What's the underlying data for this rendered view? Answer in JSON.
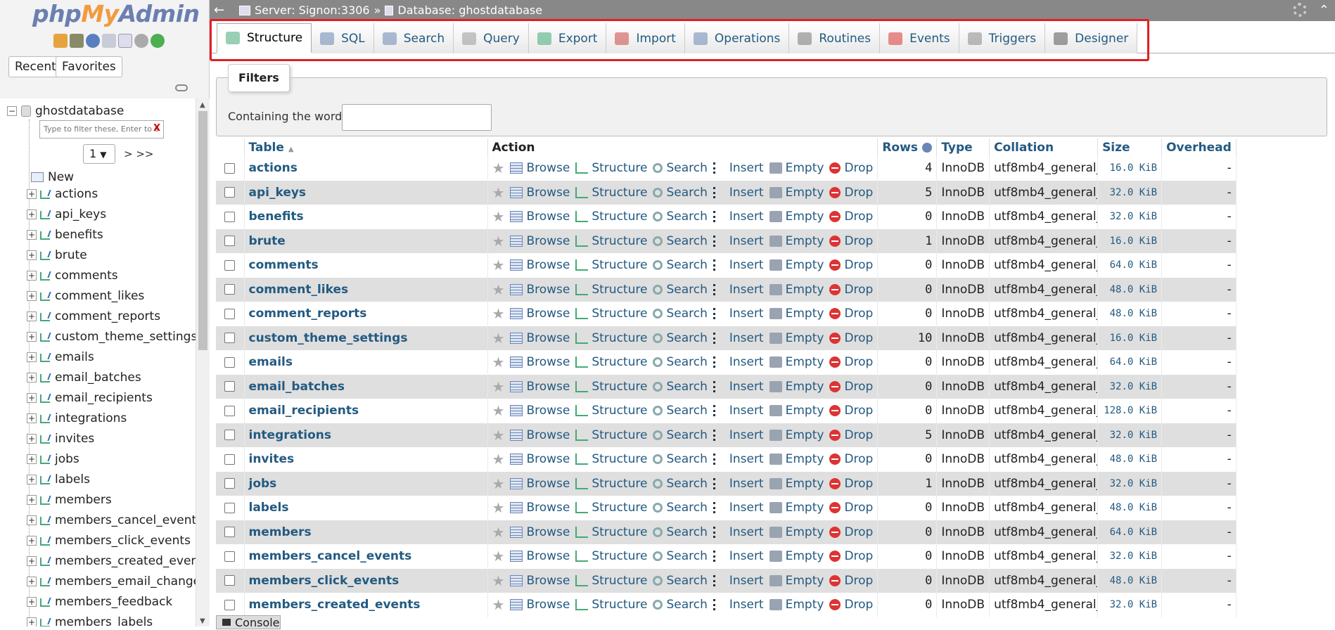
{
  "logo": {
    "php": "php",
    "my": "My",
    "admin": "Admin"
  },
  "sidebar": {
    "recent": "Recent",
    "favorites": "Favorites",
    "database": "ghostdatabase",
    "filter_placeholder": "Type to filter these, Enter to s",
    "filter_clear": "X",
    "page": "1",
    "page_next": "> >>",
    "new_label": "New",
    "tables": [
      "actions",
      "api_keys",
      "benefits",
      "brute",
      "comments",
      "comment_likes",
      "comment_reports",
      "custom_theme_settings",
      "emails",
      "email_batches",
      "email_recipients",
      "integrations",
      "invites",
      "jobs",
      "labels",
      "members",
      "members_cancel_events",
      "members_click_events",
      "members_created_events",
      "members_email_change_e",
      "members_feedback",
      "members_labels"
    ]
  },
  "topbar": {
    "server": "Server: Signon:3306",
    "sep": "»",
    "database": "Database: ghostdatabase"
  },
  "tabs": [
    {
      "label": "Structure",
      "icon": "structure-icon"
    },
    {
      "label": "SQL",
      "icon": "sql-icon"
    },
    {
      "label": "Search",
      "icon": "search-icon"
    },
    {
      "label": "Query",
      "icon": "query-icon"
    },
    {
      "label": "Export",
      "icon": "export-icon"
    },
    {
      "label": "Import",
      "icon": "import-icon"
    },
    {
      "label": "Operations",
      "icon": "wrench-icon"
    },
    {
      "label": "Routines",
      "icon": "routines-icon"
    },
    {
      "label": "Events",
      "icon": "clock-icon"
    },
    {
      "label": "Triggers",
      "icon": "triggers-icon"
    },
    {
      "label": "Designer",
      "icon": "designer-icon"
    }
  ],
  "filters": {
    "legend": "Filters",
    "label": "Containing the word:"
  },
  "table_headers": {
    "table": "Table",
    "action": "Action",
    "rows": "Rows",
    "type": "Type",
    "collation": "Collation",
    "size": "Size",
    "overhead": "Overhead"
  },
  "action_labels": {
    "browse": "Browse",
    "structure": "Structure",
    "search": "Search",
    "insert": "Insert",
    "empty": "Empty",
    "drop": "Drop"
  },
  "rows": [
    {
      "name": "actions",
      "rows": "4",
      "type": "InnoDB",
      "collation": "utf8mb4_general_ci",
      "size": "16.0 KiB",
      "overhead": "-"
    },
    {
      "name": "api_keys",
      "rows": "5",
      "type": "InnoDB",
      "collation": "utf8mb4_general_ci",
      "size": "32.0 KiB",
      "overhead": "-"
    },
    {
      "name": "benefits",
      "rows": "0",
      "type": "InnoDB",
      "collation": "utf8mb4_general_ci",
      "size": "32.0 KiB",
      "overhead": "-"
    },
    {
      "name": "brute",
      "rows": "1",
      "type": "InnoDB",
      "collation": "utf8mb4_general_ci",
      "size": "16.0 KiB",
      "overhead": "-"
    },
    {
      "name": "comments",
      "rows": "0",
      "type": "InnoDB",
      "collation": "utf8mb4_general_ci",
      "size": "64.0 KiB",
      "overhead": "-"
    },
    {
      "name": "comment_likes",
      "rows": "0",
      "type": "InnoDB",
      "collation": "utf8mb4_general_ci",
      "size": "48.0 KiB",
      "overhead": "-"
    },
    {
      "name": "comment_reports",
      "rows": "0",
      "type": "InnoDB",
      "collation": "utf8mb4_general_ci",
      "size": "48.0 KiB",
      "overhead": "-"
    },
    {
      "name": "custom_theme_settings",
      "rows": "10",
      "type": "InnoDB",
      "collation": "utf8mb4_general_ci",
      "size": "16.0 KiB",
      "overhead": "-"
    },
    {
      "name": "emails",
      "rows": "0",
      "type": "InnoDB",
      "collation": "utf8mb4_general_ci",
      "size": "64.0 KiB",
      "overhead": "-"
    },
    {
      "name": "email_batches",
      "rows": "0",
      "type": "InnoDB",
      "collation": "utf8mb4_general_ci",
      "size": "32.0 KiB",
      "overhead": "-"
    },
    {
      "name": "email_recipients",
      "rows": "0",
      "type": "InnoDB",
      "collation": "utf8mb4_general_ci",
      "size": "128.0 KiB",
      "overhead": "-"
    },
    {
      "name": "integrations",
      "rows": "5",
      "type": "InnoDB",
      "collation": "utf8mb4_general_ci",
      "size": "32.0 KiB",
      "overhead": "-"
    },
    {
      "name": "invites",
      "rows": "0",
      "type": "InnoDB",
      "collation": "utf8mb4_general_ci",
      "size": "48.0 KiB",
      "overhead": "-"
    },
    {
      "name": "jobs",
      "rows": "1",
      "type": "InnoDB",
      "collation": "utf8mb4_general_ci",
      "size": "32.0 KiB",
      "overhead": "-"
    },
    {
      "name": "labels",
      "rows": "0",
      "type": "InnoDB",
      "collation": "utf8mb4_general_ci",
      "size": "48.0 KiB",
      "overhead": "-"
    },
    {
      "name": "members",
      "rows": "0",
      "type": "InnoDB",
      "collation": "utf8mb4_general_ci",
      "size": "64.0 KiB",
      "overhead": "-"
    },
    {
      "name": "members_cancel_events",
      "rows": "0",
      "type": "InnoDB",
      "collation": "utf8mb4_general_ci",
      "size": "32.0 KiB",
      "overhead": "-"
    },
    {
      "name": "members_click_events",
      "rows": "0",
      "type": "InnoDB",
      "collation": "utf8mb4_general_ci",
      "size": "48.0 KiB",
      "overhead": "-"
    },
    {
      "name": "members_created_events",
      "rows": "0",
      "type": "InnoDB",
      "collation": "utf8mb4_general_ci",
      "size": "32.0 KiB",
      "overhead": "-"
    }
  ],
  "console": "Console",
  "colors": {
    "link": "#235a81",
    "highlight": "#e31e24",
    "topbar": "#888888",
    "row_alt": "#dfdfdf"
  }
}
